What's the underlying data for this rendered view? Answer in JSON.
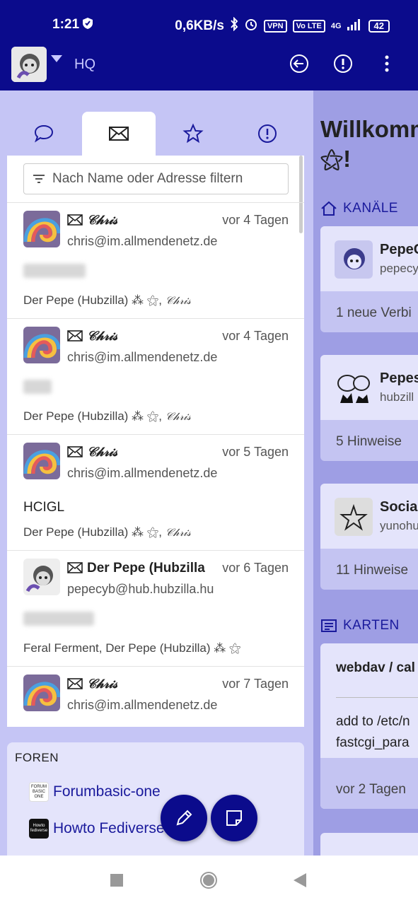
{
  "status_bar": {
    "time": "1:21",
    "network_speed": "0,6KB/s",
    "vpn": "VPN",
    "volte": "Vo LTE",
    "signal_type": "4G",
    "battery": "42"
  },
  "app_bar": {
    "title": "HQ",
    "icons": [
      "back-circle-icon",
      "alert-circle-icon",
      "more-vertical-icon"
    ]
  },
  "tabs": [
    {
      "name": "chat-bubble-icon",
      "active": false
    },
    {
      "name": "envelope-icon",
      "active": true
    },
    {
      "name": "star-icon",
      "active": false
    },
    {
      "name": "alert-circle-icon",
      "active": false
    }
  ],
  "filter": {
    "placeholder": "Nach Name oder Adresse filtern"
  },
  "messages": [
    {
      "sender": "𝒞𝒽𝓇𝒾𝓈",
      "date": "vor 4 Tagen",
      "address": "chris@im.allmendenetz.de",
      "subject": "",
      "recipients": "Der Pepe (Hubzilla) ⁂ ⚝, ",
      "recipients_sig": "𝒞𝒽𝓇𝒾𝓈",
      "avatar": "rainbow"
    },
    {
      "sender": "𝒞𝒽𝓇𝒾𝓈",
      "date": "vor 4 Tagen",
      "address": "chris@im.allmendenetz.de",
      "subject": "",
      "recipients": "Der Pepe (Hubzilla) ⁂ ⚝, ",
      "recipients_sig": "𝒞𝒽𝓇𝒾𝓈",
      "avatar": "rainbow"
    },
    {
      "sender": "𝒞𝒽𝓇𝒾𝓈",
      "date": "vor 5 Tagen",
      "address": "chris@im.allmendenetz.de",
      "subject": "HCIGL",
      "recipients": "Der Pepe (Hubzilla) ⁂ ⚝, ",
      "recipients_sig": "𝒞𝒽𝓇𝒾𝓈",
      "avatar": "rainbow"
    },
    {
      "sender": "Der Pepe (Hubzilla",
      "date": "vor 6 Tagen",
      "address": "pepecyb@hub.hubzilla.hu",
      "subject": "",
      "recipients": "Feral Ferment, Der Pepe (Hubzilla) ⁂ ⚝",
      "recipients_sig": "",
      "avatar": "pepe"
    },
    {
      "sender": "𝒞𝒽𝓇𝒾𝓈",
      "date": "vor 7 Tagen",
      "address": "chris@im.allmendenetz.de",
      "subject": "",
      "recipients": "",
      "recipients_sig": "",
      "avatar": "rainbow"
    }
  ],
  "forums": {
    "heading": "FOREN",
    "items": [
      {
        "label": "Forumbasic-one",
        "icon_text": "FORUM BASIC ONE"
      },
      {
        "label": "Howto Fediverse",
        "icon_text": "Howto fediverse"
      }
    ]
  },
  "right_panel": {
    "welcome": "Willkomm",
    "welcome_line2": "⚝!",
    "channels_heading": "KANÄLE",
    "channels": [
      {
        "name": "PepeC",
        "sub": "pepecy",
        "bottom": "1 neue Verbi"
      },
      {
        "name": "Pepes",
        "sub": "hubzill",
        "bottom": "5 Hinweise"
      },
      {
        "name": "Socia",
        "sub": "yunohu",
        "bottom": "11 Hinweise"
      }
    ],
    "cards_heading": "KARTEN",
    "card": {
      "title": "webdav / cal",
      "line1": "add to /etc/n",
      "line2": "fastcgi_para",
      "date": "vor 2 Tagen"
    }
  },
  "colors": {
    "primary": "#0b0b8c",
    "panel": "#c5c5f5",
    "link": "#1a1a9c"
  }
}
